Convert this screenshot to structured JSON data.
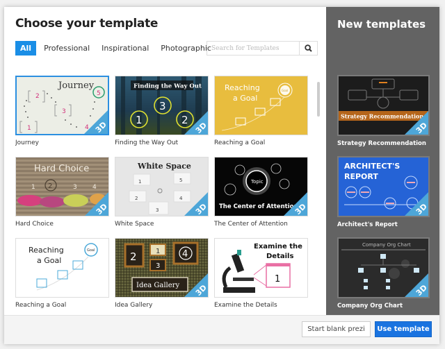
{
  "dialog": {
    "title": "Choose your template",
    "tabs": [
      {
        "label": "All",
        "active": true
      },
      {
        "label": "Professional",
        "active": false
      },
      {
        "label": "Inspirational",
        "active": false
      },
      {
        "label": "Photographic",
        "active": false
      }
    ],
    "search": {
      "placeholder": "Search for Templates",
      "value": "",
      "icon": "search-icon"
    },
    "templates": [
      {
        "name": "Journey",
        "thumb_title": "Journey",
        "badge": "3D",
        "selected": true
      },
      {
        "name": "Finding the Way Out",
        "thumb_title": "Finding the Way Out",
        "badge": "3D",
        "selected": false
      },
      {
        "name": "Reaching a Goal",
        "thumb_title": "Reaching a Goal",
        "badge": "",
        "selected": false
      },
      {
        "name": "Hard Choice",
        "thumb_title": "Hard Choice",
        "badge": "3D",
        "selected": false
      },
      {
        "name": "White Space",
        "thumb_title": "White Space",
        "badge": "3D",
        "selected": false
      },
      {
        "name": "The Center of Attention",
        "thumb_title": "The Center of Attention",
        "badge": "3D",
        "selected": false
      },
      {
        "name": "Reaching a Goal",
        "thumb_title": "Reaching a Goal",
        "badge": "",
        "selected": false
      },
      {
        "name": "Idea Gallery",
        "thumb_title": "Idea Gallery",
        "badge": "3D",
        "selected": false
      },
      {
        "name": "Examine the Details",
        "thumb_title": "Examine the Details",
        "badge": "",
        "selected": false
      }
    ],
    "thumb_text": {
      "journey_numbers": [
        "1",
        "2",
        "3",
        "4",
        "5"
      ],
      "way_out_numbers": [
        "1",
        "2",
        "3"
      ],
      "goal_label": "Goal",
      "hard_choice_numbers": [
        "1",
        "2",
        "3",
        "4"
      ],
      "center_topic": "Topic",
      "gallery_numbers": [
        "1",
        "2",
        "3",
        "4"
      ],
      "examine_number": "1"
    }
  },
  "sidebar": {
    "title": "New templates",
    "templates": [
      {
        "name": "Strategy Recommendation",
        "thumb_title": "Strategy Recommendation",
        "badge": "3D"
      },
      {
        "name": "Architect's Report",
        "thumb_title": "ARCHITECT'S REPORT",
        "badge": "3D"
      },
      {
        "name": "Company Org Chart",
        "thumb_title": "Company Org Chart",
        "badge": "3D"
      }
    ]
  },
  "footer": {
    "start_blank_label": "Start blank prezi",
    "use_template_label": "Use template"
  },
  "colors": {
    "accent": "#1a8ee6",
    "primary_button": "#1a73e0",
    "badge_3d": "#4da6d8",
    "sidebar_bg": "#636363"
  }
}
